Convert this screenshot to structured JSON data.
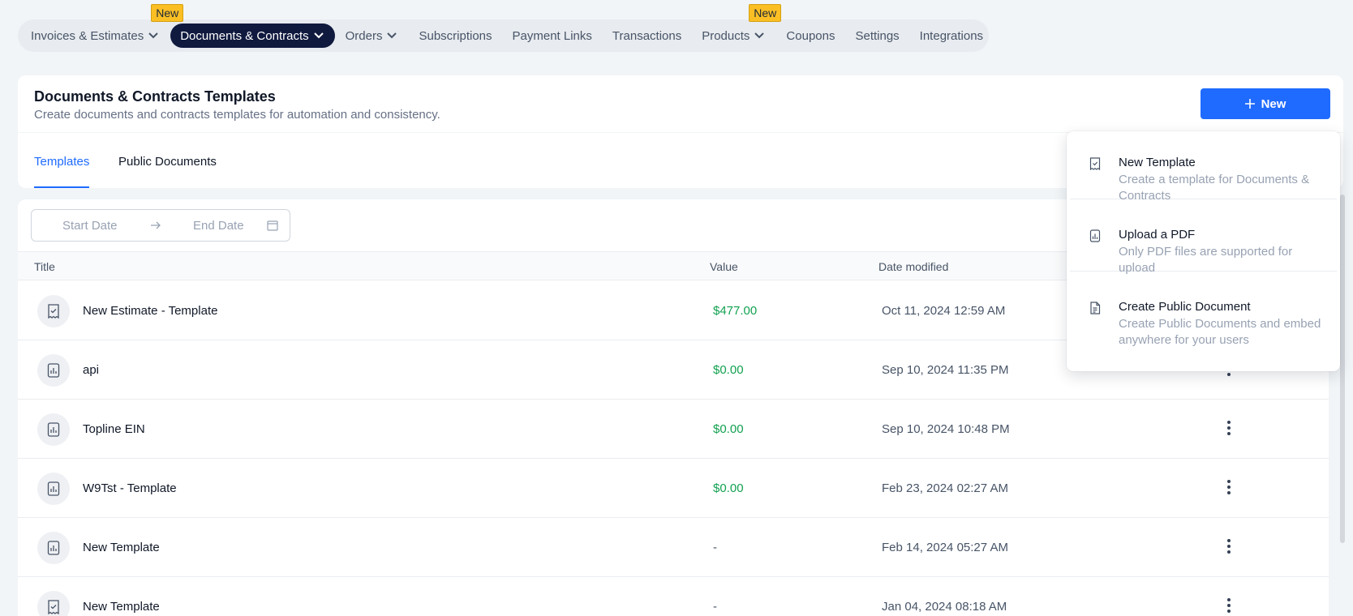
{
  "nav": {
    "items": [
      {
        "label": "Invoices & Estimates",
        "chevron": true,
        "badge": ""
      },
      {
        "label": "Documents & Contracts",
        "chevron": true,
        "badge": "",
        "active": true
      },
      {
        "label": "Orders",
        "chevron": true,
        "badge": ""
      },
      {
        "label": "Subscriptions",
        "chevron": false,
        "badge": ""
      },
      {
        "label": "Payment Links",
        "chevron": false,
        "badge": ""
      },
      {
        "label": "Transactions",
        "chevron": false,
        "badge": ""
      },
      {
        "label": "Products",
        "chevron": true,
        "badge": ""
      },
      {
        "label": "Coupons",
        "chevron": false,
        "badge": ""
      },
      {
        "label": "Settings",
        "chevron": false,
        "badge": ""
      },
      {
        "label": "Integrations",
        "chevron": false,
        "badge": ""
      }
    ],
    "badge_left": "New",
    "badge_right": "New"
  },
  "header": {
    "title": "Documents & Contracts Templates",
    "subtitle": "Create documents and contracts templates for automation and consistency.",
    "new_button": "New"
  },
  "tabs": {
    "templates": "Templates",
    "public_documents": "Public Documents"
  },
  "filters": {
    "start_placeholder": "Start Date",
    "end_placeholder": "End Date"
  },
  "table": {
    "columns": {
      "title": "Title",
      "value": "Value",
      "date": "Date modified"
    },
    "rows": [
      {
        "title": "New Estimate - Template",
        "value": "$477.00",
        "date": "Oct 11, 2024 12:59 AM",
        "icon": "receipt-check-icon"
      },
      {
        "title": "api",
        "value": "$0.00",
        "date": "Sep 10, 2024 11:35 PM",
        "icon": "chart-document-icon"
      },
      {
        "title": "Topline EIN",
        "value": "$0.00",
        "date": "Sep 10, 2024 10:48 PM",
        "icon": "chart-document-icon"
      },
      {
        "title": "W9Tst - Template",
        "value": "$0.00",
        "date": "Feb 23, 2024 02:27 AM",
        "icon": "chart-document-icon"
      },
      {
        "title": "New Template",
        "value": "-",
        "date": "Feb 14, 2024 05:27 AM",
        "icon": "chart-document-icon"
      },
      {
        "title": "New Template",
        "value": "-",
        "date": "Jan 04, 2024 08:18 AM",
        "icon": "receipt-check-icon"
      }
    ]
  },
  "dropdown": {
    "items": [
      {
        "title": "New Template",
        "desc": "Create a template for Documents & Contracts",
        "icon": "receipt-check-icon"
      },
      {
        "title": "Upload a PDF",
        "desc": "Only PDF files are supported for upload",
        "icon": "chart-document-icon"
      },
      {
        "title": "Create Public Document",
        "desc": "Create Public Documents and embed anywhere for your users",
        "icon": "file-text-icon"
      }
    ]
  },
  "colors": {
    "accent": "#1f6bff",
    "nav_active": "#101a3f",
    "badge": "#fbbf24",
    "value_green": "#12a150"
  }
}
